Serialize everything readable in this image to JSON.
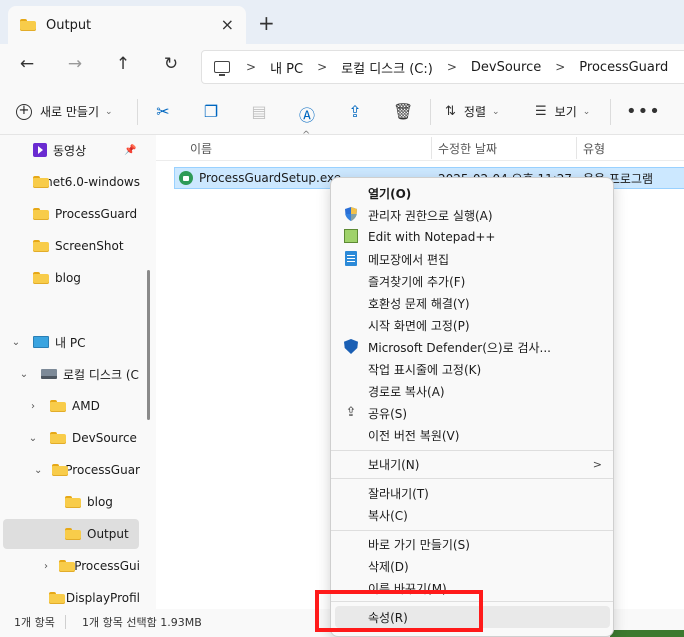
{
  "tab": {
    "title": "Output",
    "close_icon": "×",
    "new_tab_icon": "+"
  },
  "nav": {
    "back_icon": "←",
    "forward_icon": "→",
    "up_icon": "↑",
    "refresh_icon": "↻",
    "breadcrumb": [
      "내 PC",
      "로컬 디스크 (C:)",
      "DevSource",
      "ProcessGuard"
    ],
    "separator": ">"
  },
  "toolbar": {
    "new_label": "새로 만들기",
    "sort_label": "정렬",
    "view_label": "보기",
    "more_icon": "•••",
    "icons": [
      "cut-icon",
      "copy-icon",
      "paste-icon",
      "rename-icon",
      "share-icon",
      "delete-icon"
    ]
  },
  "sidebar": {
    "items": [
      {
        "label": "동영상",
        "icon": "video-icon",
        "pinned": true
      },
      {
        "label": "net6.0-windows",
        "icon": "folder-icon"
      },
      {
        "label": "ProcessGuard",
        "icon": "folder-icon"
      },
      {
        "label": "ScreenShot",
        "icon": "folder-icon"
      },
      {
        "label": "blog",
        "icon": "folder-icon"
      },
      {
        "label": "내 PC",
        "icon": "monitor-icon",
        "expanded": true
      },
      {
        "label": "로컬 디스크 (C",
        "icon": "drive-icon",
        "expanded": true
      },
      {
        "label": "AMD",
        "icon": "folder-icon",
        "expanded": false
      },
      {
        "label": "DevSource",
        "icon": "folder-icon",
        "expanded": true
      },
      {
        "label": "ProcessGuar",
        "icon": "folder-icon",
        "expanded": true
      },
      {
        "label": "blog",
        "icon": "folder-icon"
      },
      {
        "label": "Output",
        "icon": "folder-icon",
        "selected": true
      },
      {
        "label": "ProcessGui",
        "icon": "folder-icon",
        "expanded": false
      },
      {
        "label": "DisplayProfil",
        "icon": "folder-icon"
      }
    ]
  },
  "filelist": {
    "columns": [
      "이름",
      "수정한 날짜",
      "유형"
    ],
    "rows": [
      {
        "name": "ProcessGuardSetup.exe",
        "date": "2025-02-04 오후 11:27",
        "type": "응용 프로그램"
      }
    ]
  },
  "status": {
    "count": "1개 항목",
    "selection": "1개 항목 선택함 1.93MB"
  },
  "context_menu": {
    "items": [
      {
        "label": "열기(O)",
        "bold": true
      },
      {
        "label": "관리자 권한으로 실행(A)",
        "icon": "uac-shield-icon"
      },
      {
        "label": "Edit with Notepad++",
        "icon": "notepadpp-icon"
      },
      {
        "label": "메모장에서 편집",
        "icon": "notepad-icon"
      },
      {
        "label": "즐겨찾기에 추가(F)"
      },
      {
        "label": "호환성 문제 해결(Y)"
      },
      {
        "label": "시작 화면에 고정(P)"
      },
      {
        "label": "Microsoft Defender(으)로 검사...",
        "icon": "defender-icon"
      },
      {
        "label": "작업 표시줄에 고정(K)"
      },
      {
        "label": "경로로 복사(A)"
      },
      {
        "label": "공유(S)",
        "icon": "share-icon"
      },
      {
        "label": "이전 버전 복원(V)"
      },
      {
        "label": "보내기(N)",
        "submenu": true
      },
      {
        "label": "잘라내기(T)"
      },
      {
        "label": "복사(C)"
      },
      {
        "label": "바로 가기 만들기(S)"
      },
      {
        "label": "삭제(D)"
      },
      {
        "label": "이름 바꾸기(M)"
      },
      {
        "label": "속성(R)",
        "hover": true
      }
    ],
    "submenu_arrow": ">"
  },
  "colors": {
    "highlight_red": "#ff1a1a",
    "selection_blue": "#cce8ff",
    "accent": "#0067c0"
  }
}
